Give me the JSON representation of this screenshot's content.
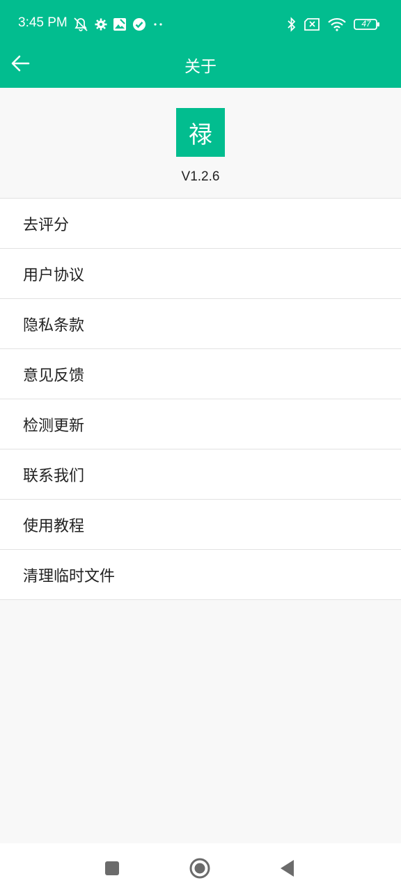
{
  "status": {
    "time": "3:45 PM",
    "battery": "47",
    "left_icons": [
      "bell-off-icon",
      "gear-icon",
      "photo-icon",
      "check-circle-icon",
      "more-dots-icon"
    ],
    "right_icons": [
      "bluetooth-icon",
      "sim-off-icon",
      "wifi-icon",
      "battery-icon"
    ]
  },
  "appbar": {
    "title": "关于",
    "back_icon": "arrow-left-icon"
  },
  "app": {
    "logo_glyph": "禄",
    "version": "V1.2.6"
  },
  "menu": {
    "items": [
      {
        "label": "去评分"
      },
      {
        "label": "用户协议"
      },
      {
        "label": "隐私条款"
      },
      {
        "label": "意见反馈"
      },
      {
        "label": "检测更新"
      },
      {
        "label": "联系我们"
      },
      {
        "label": "使用教程"
      },
      {
        "label": "清理临时文件"
      }
    ]
  },
  "colors": {
    "accent": "#02bd8f",
    "background": "#f8f8f8",
    "text": "#222222",
    "divider": "#e2e2e2"
  },
  "navbar": {
    "buttons": [
      "recents-square-icon",
      "home-circle-icon",
      "back-triangle-icon"
    ]
  }
}
